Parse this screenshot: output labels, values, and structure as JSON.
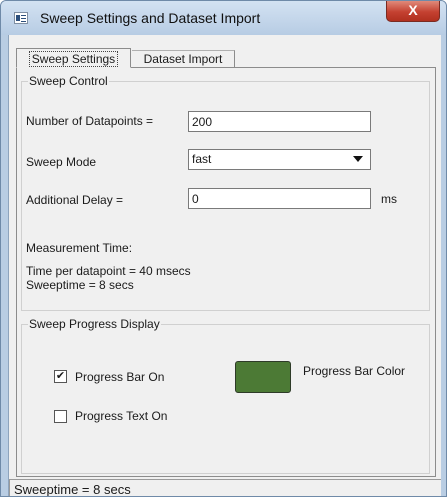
{
  "window": {
    "title": "Sweep Settings and Dataset Import",
    "close_label": "X"
  },
  "tabs": [
    {
      "label": "Sweep Settings",
      "active": true
    },
    {
      "label": "Dataset Import",
      "active": false
    }
  ],
  "sweep_control": {
    "legend": "Sweep Control",
    "datapoints_label": "Number of Datapoints =",
    "datapoints_value": "200",
    "mode_label": "Sweep Mode",
    "mode_value": "fast",
    "delay_label": "Additional Delay =",
    "delay_value": "0",
    "delay_unit": "ms",
    "measurement_label": "Measurement Time:",
    "time_per_datapoint": "Time per datapoint = 40 msecs",
    "sweeptime": "Sweeptime = 8 secs"
  },
  "progress_display": {
    "legend": "Sweep Progress Display",
    "bar_on_label": "Progress Bar On",
    "bar_on_checked": true,
    "text_on_label": "Progress Text On",
    "text_on_checked": false,
    "bar_color_label": "Progress Bar Color",
    "bar_color": "#4c7a35",
    "check_mark": "✔"
  },
  "status_bar": {
    "text": "Sweeptime = 8 secs"
  }
}
